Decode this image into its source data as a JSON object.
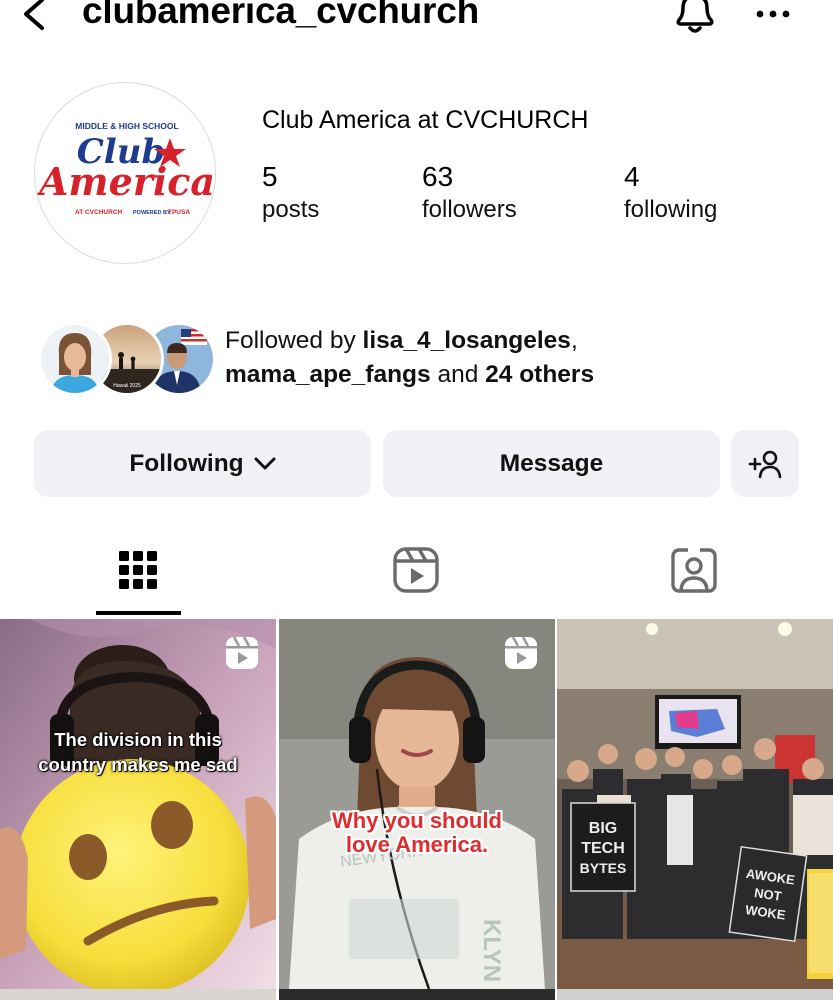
{
  "header": {
    "username": "clubamerica_cvchurch",
    "back_icon": "chevron-left-icon",
    "notification_icon": "bell-icon",
    "more_icon": "more-horizontal-icon"
  },
  "profile": {
    "avatar_logo": {
      "line1": "MIDDLE & HIGH SCHOOL",
      "line2": "Club",
      "line3": "America",
      "line4": "AT CVCHURCH",
      "line5": "POWERED BY",
      "line6": "TPUSA",
      "colors": {
        "blue": "#1d3c8f",
        "red": "#d7222b"
      }
    },
    "display_name": "Club America at CVCHURCH",
    "stats": {
      "posts_count": "5",
      "posts_label": "posts",
      "followers_count": "63",
      "followers_label": "followers",
      "following_count": "4",
      "following_label": "following"
    }
  },
  "followed_by": {
    "prefix": "Followed by ",
    "user1": "lisa_4_losangeles",
    "sep": ",",
    "user2": "mama_ape_fangs",
    "and": " and ",
    "others": "24 others",
    "avatar2_caption": "Hawaii 2025"
  },
  "actions": {
    "following_label": "Following",
    "message_label": "Message",
    "add_user_icon": "add-person-icon"
  },
  "tabs": {
    "grid_icon": "grid-icon",
    "reels_icon": "reels-icon",
    "tagged_icon": "tagged-person-icon",
    "active": "grid"
  },
  "posts": [
    {
      "type": "reel",
      "caption_line1": "The division in this",
      "caption_line2": "country makes me sad"
    },
    {
      "type": "reel",
      "caption_line1": "Why you should",
      "caption_line2": "love America."
    },
    {
      "type": "photo",
      "sign1_line1": "BIG",
      "sign1_line2": "TECH",
      "sign1_line3": "BYTES",
      "sign2_line1": "AWOKE",
      "sign2_line2": "NOT",
      "sign2_line3": "WOKE"
    }
  ],
  "colors": {
    "button_bg": "#eff1f4",
    "text": "#000000",
    "reel_red_caption": "#e02b2f"
  }
}
